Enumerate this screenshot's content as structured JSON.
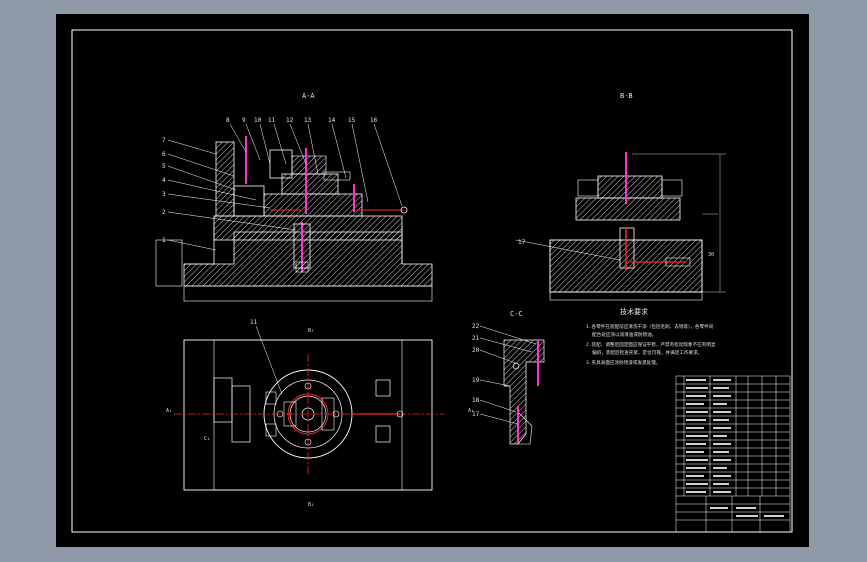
{
  "drawing": {
    "views": {
      "main_section": "A-A",
      "side_section": "B-B",
      "small_section": "C-C",
      "plan_top": "B↑",
      "plan_bottom": "B↓",
      "plan_left": "A↓",
      "plan_right": "A↓",
      "plan_center_label": "C↓"
    },
    "part_numbers_left": [
      "7",
      "6",
      "5",
      "4",
      "3",
      "2",
      "1"
    ],
    "part_numbers_top": [
      "8",
      "9",
      "10",
      "11",
      "12",
      "13",
      "14",
      "15",
      "16"
    ],
    "part_numbers_cc": [
      "22",
      "21",
      "20",
      "19",
      "18",
      "17"
    ],
    "side_labels": [
      "17"
    ],
    "tech_title": "技术要求",
    "tech_lines": [
      "1.各零件在装配前应清洗干净（包括毛刺、去锈等），各零件间",
      "配合处应涂以润滑油或防锈油。",
      "2.装配、调整后固定面应保证平稳，严禁有松动现象不应有明显",
      "偏斜，装配后检查夹紧、定位可靠，并满足工作要求。",
      "3.夹具表面应涂防锈漆或发黑处理。"
    ],
    "dimension_label": "30",
    "plan_callout": "11"
  },
  "colors": {
    "line": "#ffffff",
    "red": "#ff2222",
    "magenta": "#ff33cc",
    "hatch": "#ffffff",
    "frame_bg": "#000000",
    "outer_bg": "#8f9aa8"
  }
}
